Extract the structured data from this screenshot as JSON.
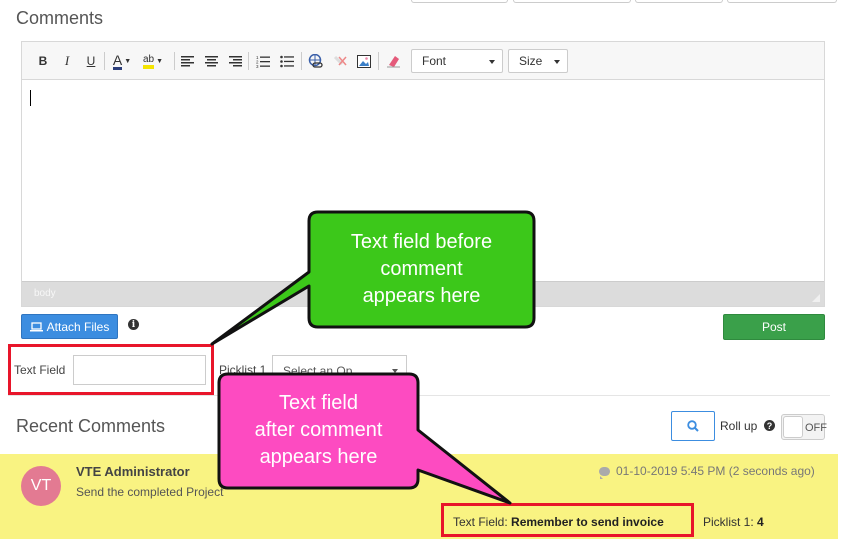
{
  "comments": {
    "title": "Comments"
  },
  "toolbar": {
    "bold": "B",
    "italic": "I",
    "underline": "U",
    "font_color": "A",
    "highlight": "ab",
    "font_label": "Font",
    "size_label": "Size"
  },
  "editor": {
    "path": "body"
  },
  "actions": {
    "attach_label": "Attach Files",
    "post_label": "Post"
  },
  "fields": {
    "text_field_label": "Text Field",
    "text_field_value": "",
    "picklist_label": "Picklist 1",
    "picklist_value": "Select an Op"
  },
  "recent": {
    "title": "Recent Comments",
    "rollup_label": "Roll up",
    "toggle_label": "OFF"
  },
  "comment": {
    "avatar_initials": "VT",
    "author": "VTE Administrator",
    "text": "Send the completed Project",
    "timestamp": "01-10-2019 5:45 PM (2 seconds ago)",
    "text_field_label": "Text Field:",
    "text_field_value": "Remember to send invoice",
    "picklist_label": "Picklist 1:",
    "picklist_value": "4"
  },
  "callouts": {
    "green_lines": [
      "Text field before",
      "comment",
      "appears here"
    ],
    "pink_lines": [
      "Text field",
      "after comment",
      "appears here"
    ]
  },
  "colors": {
    "callout_green": "#3cc81a",
    "callout_pink": "#fd4bc1",
    "highlight_red": "#e8152a",
    "comment_bg": "#f9f382",
    "primary_blue": "#3c8de0",
    "post_green": "#3aa04a"
  }
}
